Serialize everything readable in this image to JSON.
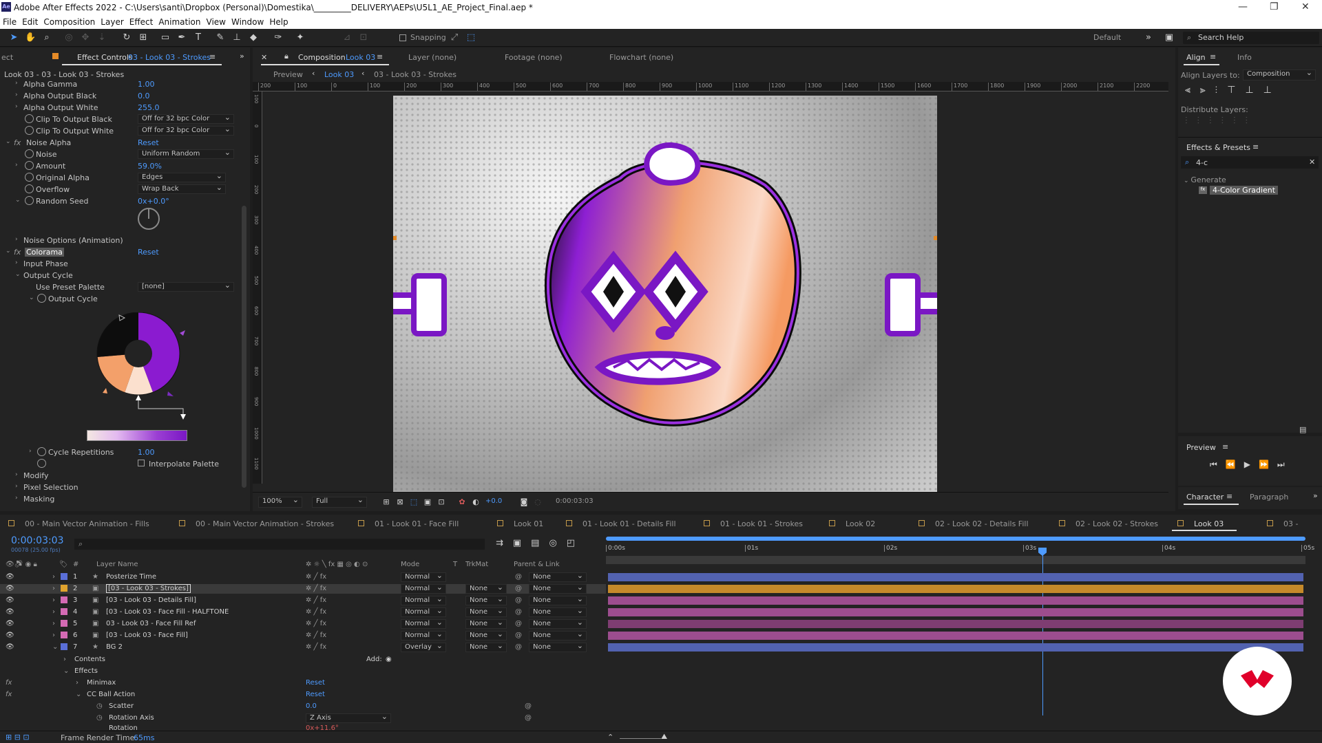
{
  "titlebar": {
    "logo": "Ae",
    "title": "Adobe After Effects 2022 - C:\\Users\\santi\\Dropbox (Personal)\\Domestika\\_________DELIVERY\\AEPs\\U5L1_AE_Project_Final.aep *"
  },
  "menu": [
    "File",
    "Edit",
    "Composition",
    "Layer",
    "Effect",
    "Animation",
    "View",
    "Window",
    "Help"
  ],
  "toolbar": {
    "snapping": "Snapping",
    "workspace": "Default",
    "search_placeholder": "Search Help"
  },
  "effect_controls": {
    "tab_prefix": "ect",
    "tab_label": "Effect Controls",
    "tab_target": "03 - Look 03 - Strokes",
    "subheader": "Look 03 - 03 - Look 03 - Strokes",
    "rows": [
      {
        "label": "Alpha Gamma",
        "value": "1.00"
      },
      {
        "label": "Alpha Output Black",
        "value": "0.0"
      },
      {
        "label": "Alpha Output White",
        "value": "255.0"
      },
      {
        "label": "Clip To Output Black",
        "dropdown": "Off for 32 bpc Color"
      },
      {
        "label": "Clip To Output White",
        "dropdown": "Off for 32 bpc Color"
      },
      {
        "label": "Noise Alpha",
        "value": "Reset"
      },
      {
        "label": "Noise",
        "dropdown": "Uniform Random"
      },
      {
        "label": "Amount",
        "value": "59.0%"
      },
      {
        "label": "Original Alpha",
        "dropdown": "Edges"
      },
      {
        "label": "Overflow",
        "dropdown": "Wrap Back"
      },
      {
        "label": "Random Seed",
        "value": "0x+0.0°"
      },
      {
        "label": "Noise Options (Animation)"
      },
      {
        "label": "Colorama",
        "value": "Reset"
      },
      {
        "label": "Input Phase"
      },
      {
        "label": "Output Cycle"
      },
      {
        "label": "Use Preset Palette",
        "dropdown": "[none]"
      },
      {
        "label": "Output Cycle"
      },
      {
        "label": "Cycle Repetitions",
        "value": "1.00"
      },
      {
        "label": "Interpolate Palette"
      },
      {
        "label": "Modify"
      },
      {
        "label": "Pixel Selection"
      },
      {
        "label": "Masking"
      }
    ]
  },
  "composition": {
    "tab_label": "Composition",
    "tab_name": "Look 03",
    "layer_tab": "Layer  (none)",
    "footage_tab": "Footage  (none)",
    "flowchart_tab": "Flowchart  (none)",
    "breadcrumb": [
      "Preview",
      "Look 03",
      "03 - Look 03 - Strokes"
    ],
    "ruler": [
      "200",
      "100",
      "0",
      "100",
      "200",
      "300",
      "400",
      "500",
      "600",
      "700",
      "800",
      "900",
      "1000",
      "1100",
      "1200",
      "1300",
      "1400",
      "1500",
      "1600",
      "1700",
      "1800",
      "1900",
      "2000",
      "2100",
      "2200"
    ],
    "vruler": [
      "100",
      "0",
      "100",
      "200",
      "300",
      "400",
      "500",
      "600",
      "700",
      "800",
      "900",
      "1000",
      "1100"
    ],
    "zoom": "100%",
    "resolution": "Full",
    "exposure": "+0.0",
    "timecode": "0:00:03:03"
  },
  "align": {
    "tab": "Align",
    "info_tab": "Info",
    "align_to_label": "Align Layers to:",
    "align_to": "Composition",
    "distribute": "Distribute Layers:"
  },
  "effects_presets": {
    "tab": "Effects & Presets",
    "search": "4-c",
    "category": "Generate",
    "item": "4-Color Gradient"
  },
  "preview": {
    "tab": "Preview"
  },
  "character": {
    "tab": "Character",
    "paragraph_tab": "Paragraph"
  },
  "timeline": {
    "tabs": [
      "00 - Main Vector Animation - Fills",
      "00 - Main Vector Animation - Strokes",
      "01 - Look 01 - Face Fill",
      "Look 01",
      "01 - Look 01 - Details Fill",
      "01 - Look 01 - Strokes",
      "Look 02",
      "02 - Look 02 - Details Fill",
      "02 - Look 02 - Strokes",
      "Look 03",
      "03 -"
    ],
    "timecode": "0:00:03:03",
    "frames": "00078 (25.00 fps)",
    "columns": {
      "num": "#",
      "layer_name": "Layer Name",
      "mode": "Mode",
      "t": "T",
      "trkmat": "TrkMat",
      "parent": "Parent & Link"
    },
    "time_marks": [
      "0:00s",
      "01s",
      "02s",
      "03s",
      "04s",
      "05s"
    ],
    "layers": [
      {
        "num": "1",
        "name": "Posterize Time",
        "mode": "Normal",
        "trkmat": "",
        "parent": "None",
        "color": "#5a6fd8",
        "bar": "#5262b0"
      },
      {
        "num": "2",
        "name": "[03 - Look 03 - Strokes]",
        "mode": "Normal",
        "trkmat": "None",
        "parent": "None",
        "color": "#e0a32e",
        "bar": "#c5892a"
      },
      {
        "num": "3",
        "name": "[03 - Look 03 - Details Fill]",
        "mode": "Normal",
        "trkmat": "None",
        "parent": "None",
        "color": "#d46ab4",
        "bar": "#9c4d8e"
      },
      {
        "num": "4",
        "name": "[03 - Look 03 - Face Fill - HALFTONE",
        "mode": "Normal",
        "trkmat": "None",
        "parent": "None",
        "color": "#d46ab4",
        "bar": "#9c4d8e"
      },
      {
        "num": "5",
        "name": "03 - Look 03 - Face Fill Ref",
        "mode": "Normal",
        "trkmat": "None",
        "parent": "None",
        "color": "#d46ab4",
        "bar": "#7e3d72"
      },
      {
        "num": "6",
        "name": "[03 - Look 03 - Face Fill]",
        "mode": "Normal",
        "trkmat": "None",
        "parent": "None",
        "color": "#d46ab4",
        "bar": "#9c4d8e"
      },
      {
        "num": "7",
        "name": "BG 2",
        "mode": "Overlay",
        "trkmat": "None",
        "parent": "None",
        "color": "#5a6fd8",
        "bar": "#5262b0"
      }
    ],
    "sub": {
      "contents": "Contents",
      "add": "Add:",
      "effects": "Effects",
      "minimax": "Minimax",
      "reset1": "Reset",
      "ccball": "CC Ball Action",
      "reset2": "Reset",
      "scatter": "Scatter",
      "scatter_val": "0.0",
      "rotation_axis": "Rotation Axis",
      "rotation_axis_val": "Z Axis",
      "rotation": "Rotation",
      "rotation_val": "0x+11.6°"
    },
    "status": "Frame Render Time:",
    "render_time": "65ms"
  }
}
